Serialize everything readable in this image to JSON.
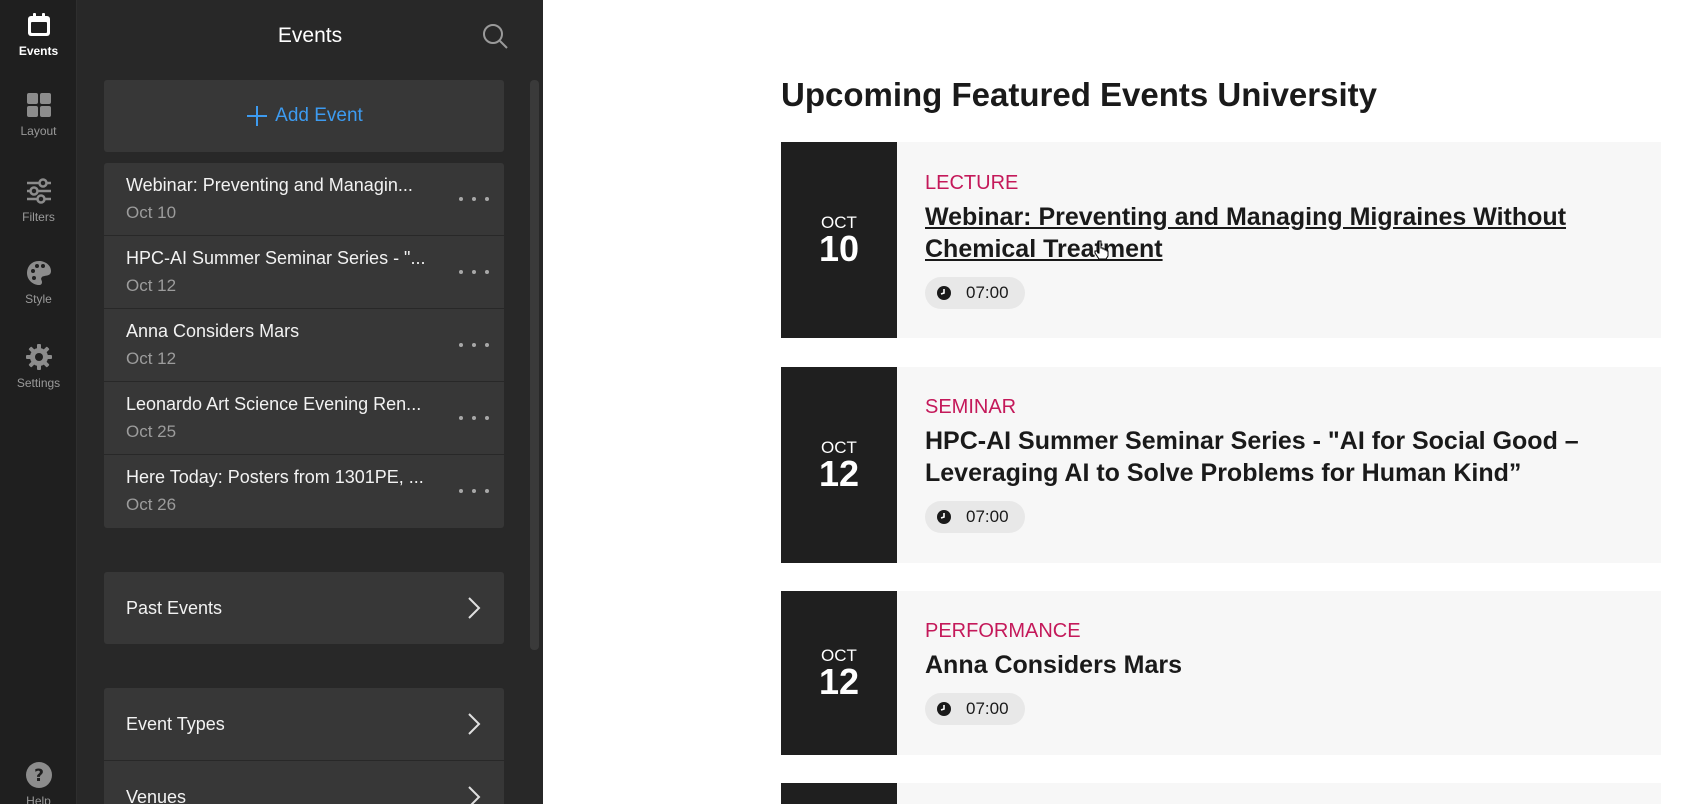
{
  "rail": {
    "items": [
      {
        "label": "Events",
        "icon": "calendar-icon",
        "active": true
      },
      {
        "label": "Layout",
        "icon": "layout-grid-icon",
        "active": false
      },
      {
        "label": "Filters",
        "icon": "sliders-icon",
        "active": false
      },
      {
        "label": "Style",
        "icon": "palette-icon",
        "active": false
      },
      {
        "label": "Settings",
        "icon": "gear-icon",
        "active": false
      }
    ],
    "help": {
      "label": "Help",
      "icon": "help-icon"
    }
  },
  "panel": {
    "title": "Events",
    "add_button": "Add Event",
    "events": [
      {
        "title": "Webinar: Preventing and Managin...",
        "date": "Oct 10"
      },
      {
        "title": "HPC-AI Summer Seminar Series - \"...",
        "date": "Oct 12"
      },
      {
        "title": "Anna Considers Mars",
        "date": "Oct 12"
      },
      {
        "title": "Leonardo Art Science Evening Ren...",
        "date": "Oct 25"
      },
      {
        "title": "Here Today: Posters from 1301PE, ...",
        "date": "Oct 26"
      }
    ],
    "past_events": "Past Events",
    "event_types": "Event Types",
    "venues": "Venues"
  },
  "main": {
    "heading": "Upcoming Featured Events University",
    "cards": [
      {
        "month": "OCT",
        "day": "10",
        "type": "LECTURE",
        "title": "Webinar: Preventing and Managing Migraines Without Chemical Treatment",
        "time": "07:00"
      },
      {
        "month": "OCT",
        "day": "12",
        "type": "SEMINAR",
        "title": "HPC-AI Summer Seminar Series - \"AI for Social Good – Leveraging AI to Solve Problems for Human Kind”",
        "time": "07:00"
      },
      {
        "month": "OCT",
        "day": "12",
        "type": "PERFORMANCE",
        "title": "Anna Considers Mars",
        "time": "07:00"
      }
    ]
  },
  "colors": {
    "accent_blue": "#3d9bf0",
    "type_pink": "#c4195a",
    "rail_bg": "#1f1f1f",
    "panel_bg": "#282828",
    "row_bg": "#373737"
  }
}
